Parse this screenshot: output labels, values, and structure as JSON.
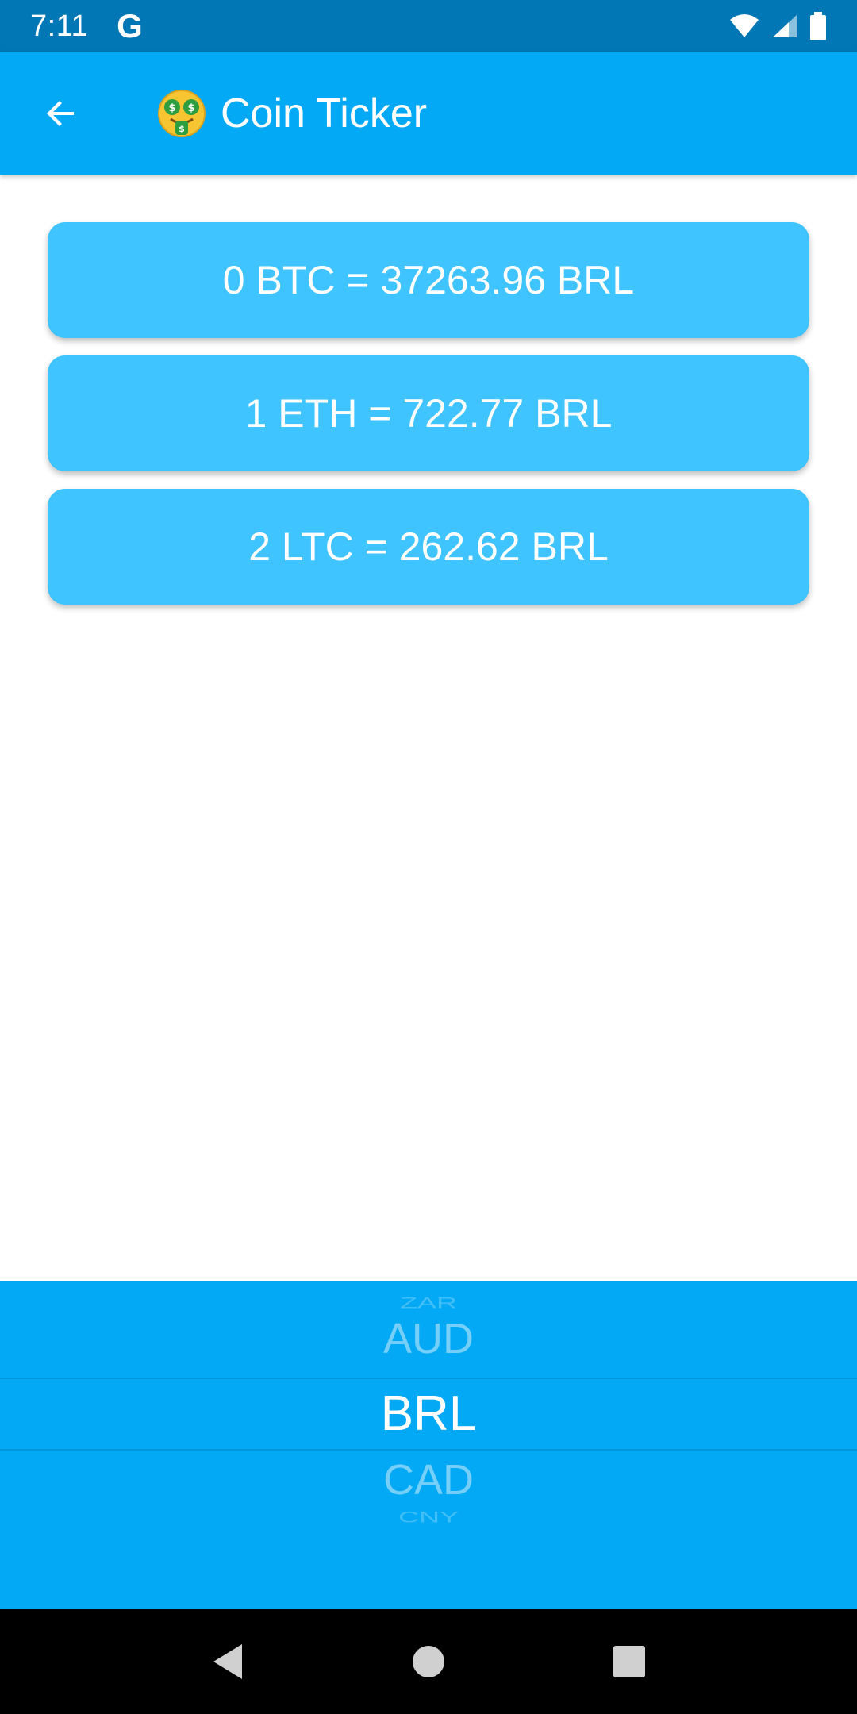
{
  "status_bar": {
    "time": "7:11",
    "g_logo": "G",
    "icons": [
      "wifi-icon",
      "signal-icon",
      "battery-icon"
    ]
  },
  "app_bar": {
    "back_icon": "arrow-left-icon",
    "title_icon": "money-mouth-face-icon",
    "title": "Coin Ticker",
    "color": "#03a9f4"
  },
  "rates": [
    {
      "text": "0 BTC = 37263.96 BRL"
    },
    {
      "text": "1 ETH = 722.77 BRL"
    },
    {
      "text": "2 LTC = 262.62 BRL"
    }
  ],
  "card_color": "#40c4ff",
  "currency_picker": {
    "items": [
      "ZAR",
      "AUD",
      "BRL",
      "CAD",
      "CNY"
    ],
    "selected": "BRL"
  },
  "nav_bar": {
    "back": "triangle-back-icon",
    "home": "circle-home-icon",
    "recents": "square-recents-icon"
  }
}
